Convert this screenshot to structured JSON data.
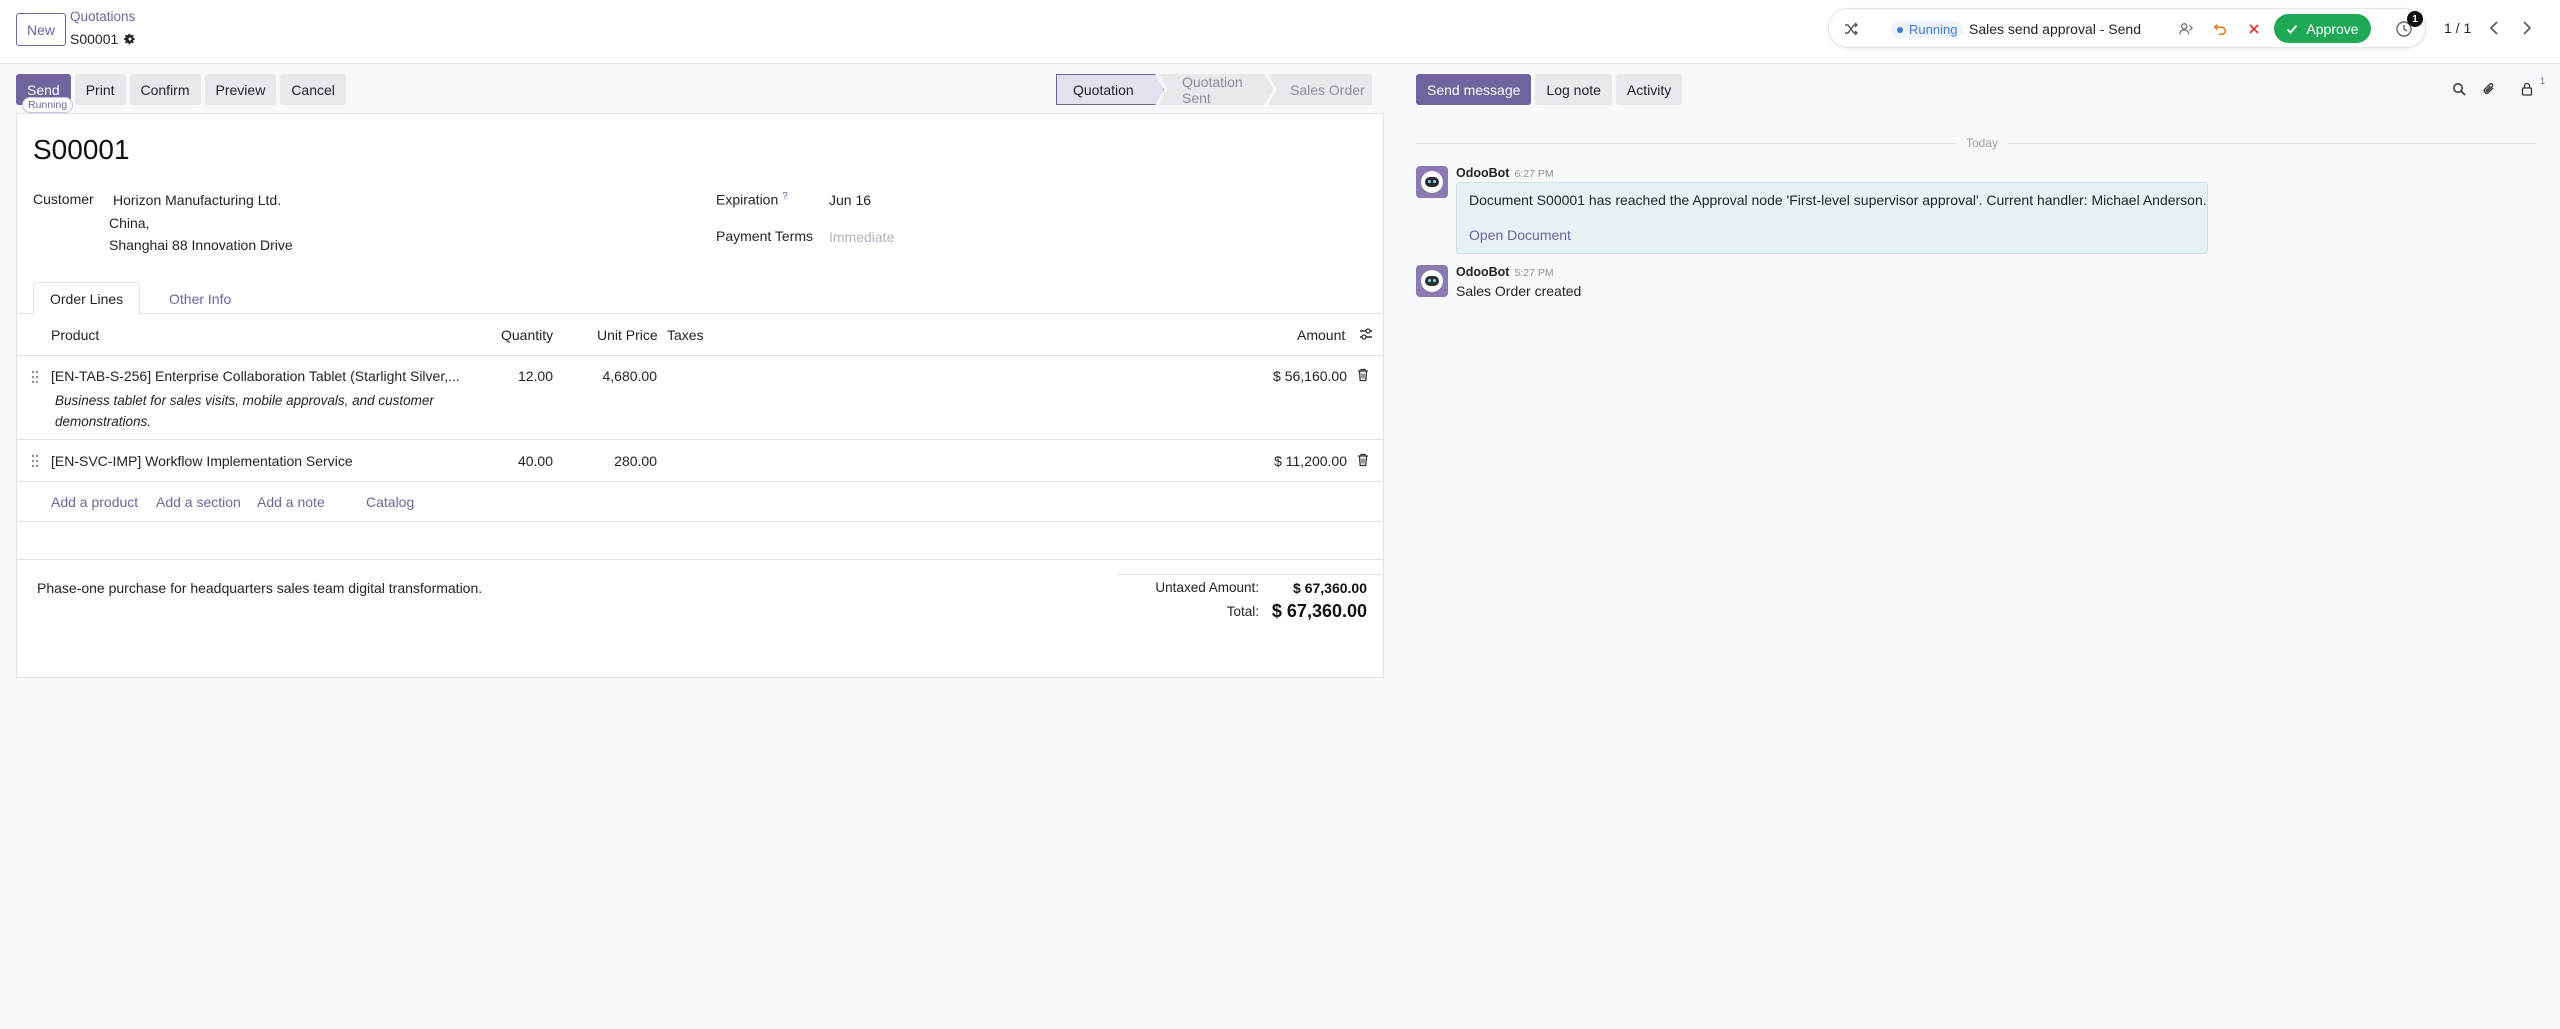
{
  "header": {
    "new_label": "New",
    "breadcrumb_parent": "Quotations",
    "breadcrumb_current": "S00001"
  },
  "approval": {
    "status": "Running",
    "title": "Sales send approval - Send",
    "approve_label": "Approve",
    "badge_count": "1"
  },
  "pager": {
    "label": "1 / 1"
  },
  "actions": {
    "send": "Send",
    "print": "Print",
    "confirm": "Confirm",
    "preview": "Preview",
    "cancel": "Cancel",
    "running_tag": "Running"
  },
  "statusbar": {
    "stages": [
      "Quotation",
      "Quotation Sent",
      "Sales Order"
    ],
    "active": "Quotation"
  },
  "form": {
    "title": "S00001",
    "customer_label": "Customer",
    "customer_name": "Horizon Manufacturing Ltd.",
    "customer_line2": "China,",
    "customer_line3": "Shanghai 88 Innovation Drive",
    "expiration_label": "Expiration",
    "expiration_help": "?",
    "expiration_value": "Jun 16",
    "payment_terms_label": "Payment Terms",
    "payment_terms_placeholder": "Immediate"
  },
  "tabs": {
    "order_lines": "Order Lines",
    "other_info": "Other Info"
  },
  "table": {
    "headers": {
      "product": "Product",
      "quantity": "Quantity",
      "unit_price": "Unit Price",
      "taxes": "Taxes",
      "amount": "Amount"
    },
    "lines": [
      {
        "product": "[EN-TAB-S-256] Enterprise Collaboration Tablet (Starlight Silver,...",
        "description_line1": "Business tablet for sales visits, mobile approvals, and customer",
        "description_line2": "demonstrations.",
        "quantity": "12.00",
        "unit_price": "4,680.00",
        "amount": "$ 56,160.00"
      },
      {
        "product": "[EN-SVC-IMP] Workflow Implementation Service",
        "quantity": "40.00",
        "unit_price": "280.00",
        "amount": "$ 11,200.00"
      }
    ],
    "add_links": {
      "product": "Add a product",
      "section": "Add a section",
      "note": "Add a note",
      "catalog": "Catalog"
    }
  },
  "footer": {
    "note": "Phase-one purchase for headquarters sales team digital transformation.",
    "untaxed_label": "Untaxed Amount:",
    "untaxed_value": "$ 67,360.00",
    "total_label": "Total:",
    "total_value": "$ 67,360.00"
  },
  "chatter": {
    "send_message": "Send message",
    "log_note": "Log note",
    "activity": "Activity",
    "followers_count": "1",
    "date_separator": "Today",
    "messages": [
      {
        "author": "OdooBot",
        "time": "6:27 PM",
        "body": "Document S00001 has reached the Approval node 'First-level supervisor approval'. Current handler: Michael Anderson.",
        "link": "Open Document"
      },
      {
        "author": "OdooBot",
        "time": "5:27 PM",
        "body": "Sales Order created"
      }
    ]
  },
  "colors": {
    "brand": "#71639e",
    "approve": "#1fa855",
    "running": "#3d7bd6",
    "note_bubble": "#e6f2f3"
  },
  "icons": [
    "shuffle-icon",
    "gear-icon",
    "assign-user-icon",
    "undo-icon",
    "reject-x-icon",
    "check-icon",
    "clock-history-icon",
    "chevron-left-icon",
    "chevron-right-icon",
    "drag-handle-icon",
    "trash-icon",
    "column-settings-icon",
    "search-icon",
    "paperclip-icon",
    "lock-follower-icon"
  ]
}
